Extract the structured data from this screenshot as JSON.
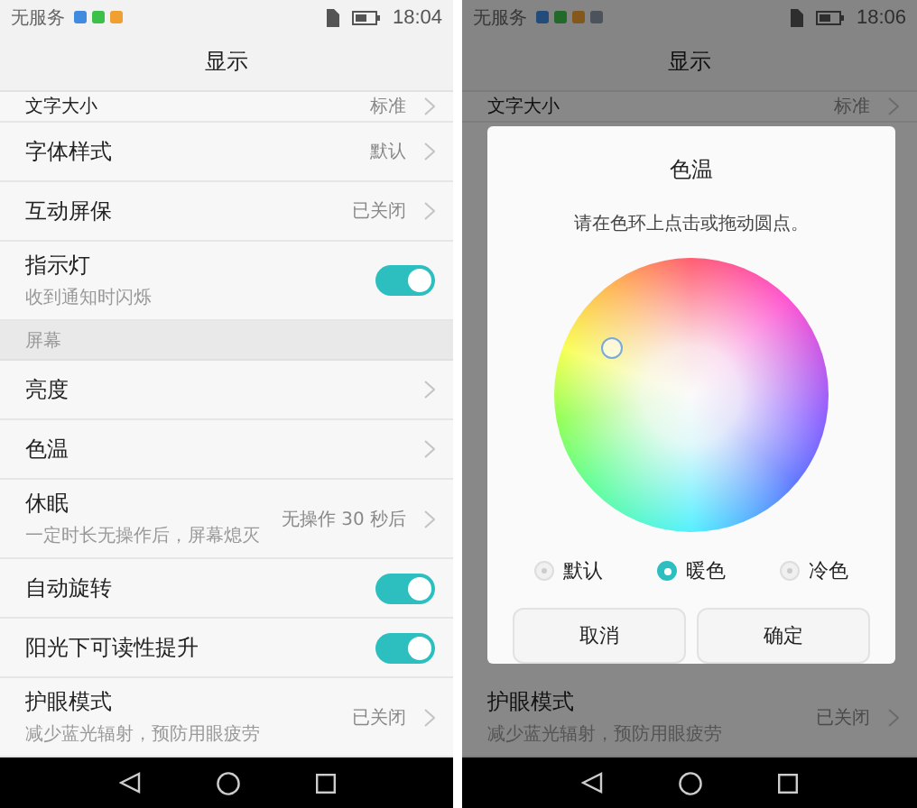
{
  "phones": [
    {
      "status": {
        "carrier": "无服务",
        "time": "18:04",
        "notifications": [
          {
            "color": "#3f8be0"
          },
          {
            "color": "#3cc04a"
          },
          {
            "color": "#f0a030"
          }
        ]
      },
      "title": "显示",
      "rows": [
        {
          "kind": "nav",
          "label": "文字大小",
          "value": "标准",
          "cut": true
        },
        {
          "kind": "nav",
          "label": "字体样式",
          "value": "默认"
        },
        {
          "kind": "nav",
          "label": "互动屏保",
          "value": "已关闭"
        },
        {
          "kind": "toggle",
          "label": "指示灯",
          "subtitle": "收到通知时闪烁",
          "on": true
        },
        {
          "kind": "section",
          "label": "屏幕"
        },
        {
          "kind": "nav",
          "label": "亮度"
        },
        {
          "kind": "nav",
          "label": "色温"
        },
        {
          "kind": "nav",
          "label": "休眠",
          "subtitle": "一定时长无操作后，屏幕熄灭",
          "value": "无操作 30 秒后"
        },
        {
          "kind": "toggle",
          "label": "自动旋转",
          "on": true
        },
        {
          "kind": "toggle",
          "label": "阳光下可读性提升",
          "on": true
        },
        {
          "kind": "nav",
          "label": "护眼模式",
          "subtitle": "减少蓝光辐射，预防用眼疲劳",
          "value": "已关闭"
        }
      ]
    },
    {
      "status": {
        "carrier": "无服务",
        "time": "18:06",
        "notifications": [
          {
            "color": "#234c7b"
          },
          {
            "color": "#216a29"
          },
          {
            "color": "#84581a"
          },
          {
            "color": "#4c535a"
          }
        ]
      },
      "title": "显示",
      "rows": [
        {
          "kind": "nav",
          "label": "文字大小",
          "value": "标准",
          "cut": true
        },
        {
          "kind": "hidden"
        },
        {
          "kind": "nav",
          "label": "护眼模式",
          "subtitle": "减少蓝光辐射，预防用眼疲劳",
          "value": "已关闭"
        }
      ],
      "dialog": {
        "title": "色温",
        "instruction": "请在色环上点击或拖动圆点。",
        "options": [
          {
            "label": "默认",
            "selected": false
          },
          {
            "label": "暖色",
            "selected": true
          },
          {
            "label": "冷色",
            "selected": false
          }
        ],
        "buttons": [
          "取消",
          "确定"
        ]
      }
    }
  ]
}
